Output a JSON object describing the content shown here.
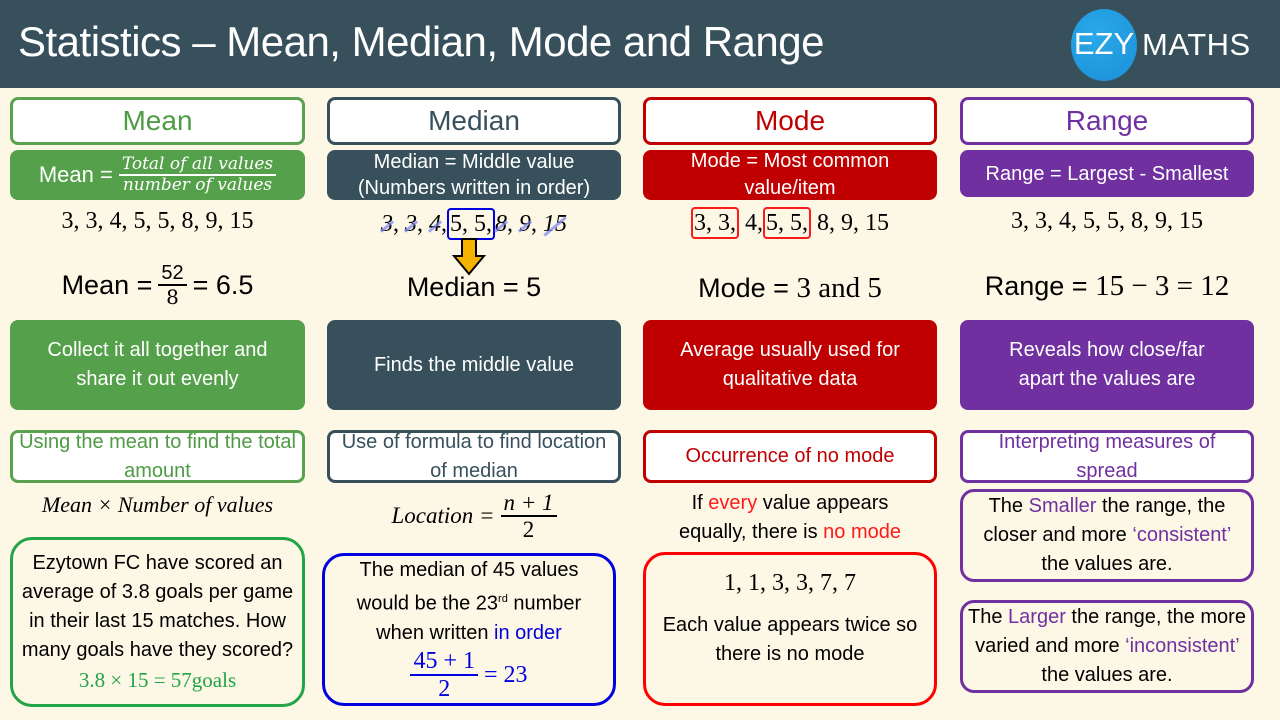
{
  "header": {
    "title": "Statistics – Mean, Median, Mode and Range",
    "logo_ezy": "EZY",
    "logo_maths": "MATHS"
  },
  "colors": {
    "header_bg": "#37505b",
    "page_bg": "#fdf7e6",
    "mean": "#55a04a",
    "median": "#37505b",
    "mode": "#c00000",
    "range": "#7030a0",
    "logo": "#1c9ad9"
  },
  "mean": {
    "heading": "Mean",
    "def_label": "Mean =",
    "def_num": "Total of all values",
    "def_den": "number of values",
    "data": "3, 3, 4, 5, 5, 8, 9, 15",
    "result_label": "Mean =",
    "result_num": "52",
    "result_den": "8",
    "result_value": "= 6.5",
    "description": "Collect it all together and share it out evenly",
    "sub_heading": "Using the mean to find the total amount",
    "formula": "Mean × Number of values",
    "example_text": "Ezytown FC have scored an average of 3.8 goals per game in their last 15 matches. How many goals have they scored?",
    "example_answer": "3.8 × 15 = 57goals"
  },
  "median": {
    "heading": "Median",
    "def_line1": "Median = Middle value",
    "def_line2": "(Numbers written in order)",
    "data": [
      "3",
      "3",
      "4",
      "5",
      "5",
      "8",
      "9",
      "15"
    ],
    "highlight": "5, 5,",
    "result_label": "Median =",
    "result_value": "5",
    "description": "Finds the middle value",
    "sub_heading": "Use of formula to find location of median",
    "formula_label": "Location =",
    "formula_num": "n + 1",
    "formula_den": "2",
    "example_line1": "The median of 45 values",
    "example_line2a": "would be the 23",
    "example_sup": "rd",
    "example_line2b": " number",
    "example_line3a": "when written ",
    "example_line3b": "in order",
    "example_num": "45 + 1",
    "example_den": "2",
    "example_result": "= 23"
  },
  "mode": {
    "heading": "Mode",
    "def_line1": "Mode = Most common",
    "def_line2": "value/item",
    "data_hl1": "3, 3,",
    "data_mid": " 4,",
    "data_hl2": "5, 5,",
    "data_end": " 8, 9, 15",
    "result_label": "Mode =",
    "result_value": "3 and 5",
    "description": "Average usually used for qualitative data",
    "sub_heading": "Occurrence of no mode",
    "rule_a": "If ",
    "rule_b": "every",
    "rule_c": " value appears equally, there is ",
    "rule_d": "no mode",
    "example_data": "1, 1, 3, 3, 7, 7",
    "example_text": "Each value appears twice so there is no mode"
  },
  "range": {
    "heading": "Range",
    "def": "Range = Largest - Smallest",
    "data": "3, 3, 4, 5, 5, 8, 9, 15",
    "result_label": "Range =",
    "result_value": "15 − 3 = 12",
    "description": "Reveals how close/far apart the values are",
    "sub_heading": "Interpreting measures of spread",
    "small_a": "The ",
    "small_b": "Smaller",
    "small_c": " the range, the closer and more ",
    "small_d": "‘consistent’",
    "small_e": " the values are.",
    "large_a": "The ",
    "large_b": "Larger",
    "large_c": " the range, the more varied and more ",
    "large_d": "‘inconsistent’",
    "large_e": " the values are."
  }
}
